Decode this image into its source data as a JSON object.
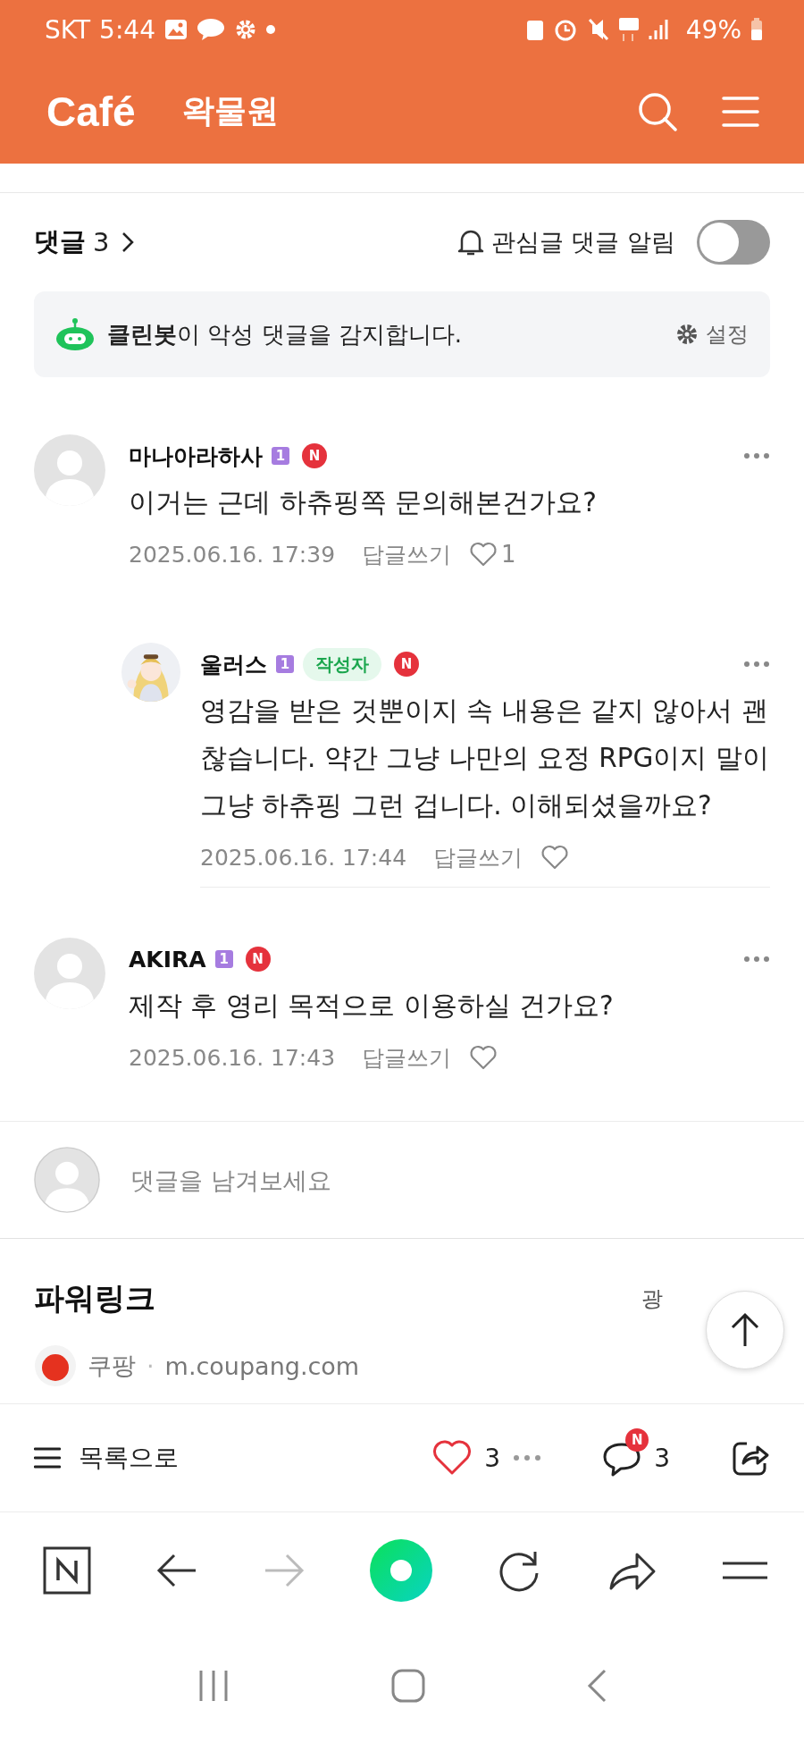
{
  "status_bar": {
    "carrier": "SKT",
    "time": "5:44",
    "battery": "49%"
  },
  "header": {
    "logo": "Café",
    "cafe_name": "왁물원"
  },
  "comments_header": {
    "title": "댓글",
    "count": "3",
    "notify_label": "관심글 댓글 알림",
    "notify_on": false
  },
  "cleanbot": {
    "notice": "**클린봇**이 악성 댓글을 감지합니다.",
    "settings": "설정"
  },
  "comments": [
    {
      "author": "마나아라하사",
      "level": "1",
      "new_badge": "N",
      "reply": false,
      "avatar": {
        "kind": "default"
      },
      "text": "이거는 근데 하츄핑쪽 문의해본건가요?",
      "date": "2025.06.16. 17:39",
      "reply_label": "답글쓰기",
      "likes": "1"
    },
    {
      "author": "울러스",
      "level": "1",
      "writer_badge": "작성자",
      "new_badge": "N",
      "reply": true,
      "text": "영감을 받은 것뿐이지 속 내용은 같지 않아서 괜찮습니다. 약간 그냥 나만의 요정 RPG이지 말이 그냥 하츄핑 그런 겁니다. 이해되셨을까요?",
      "date": "2025.06.16. 17:44",
      "reply_label": "답글쓰기"
    },
    {
      "author": "AKIRA",
      "level": "1",
      "new_badge": "N",
      "reply": false,
      "avatar": {
        "kind": "default"
      },
      "text": "제작 후 영리 목적으로 이용하실 건가요?",
      "date": "2025.06.16. 17:43",
      "reply_label": "답글쓰기"
    }
  ],
  "comment_input": {
    "placeholder": "댓글을 남겨보세요"
  },
  "powerlink": {
    "title": "파워링크",
    "ad_label": "광",
    "advertiser": "쿠팡",
    "separator": "·",
    "url": "m.coupang.com"
  },
  "bottom_bar": {
    "list_label": "목록으로",
    "liked": true,
    "likes": "3",
    "comments": "3",
    "comments_badge": "N"
  }
}
